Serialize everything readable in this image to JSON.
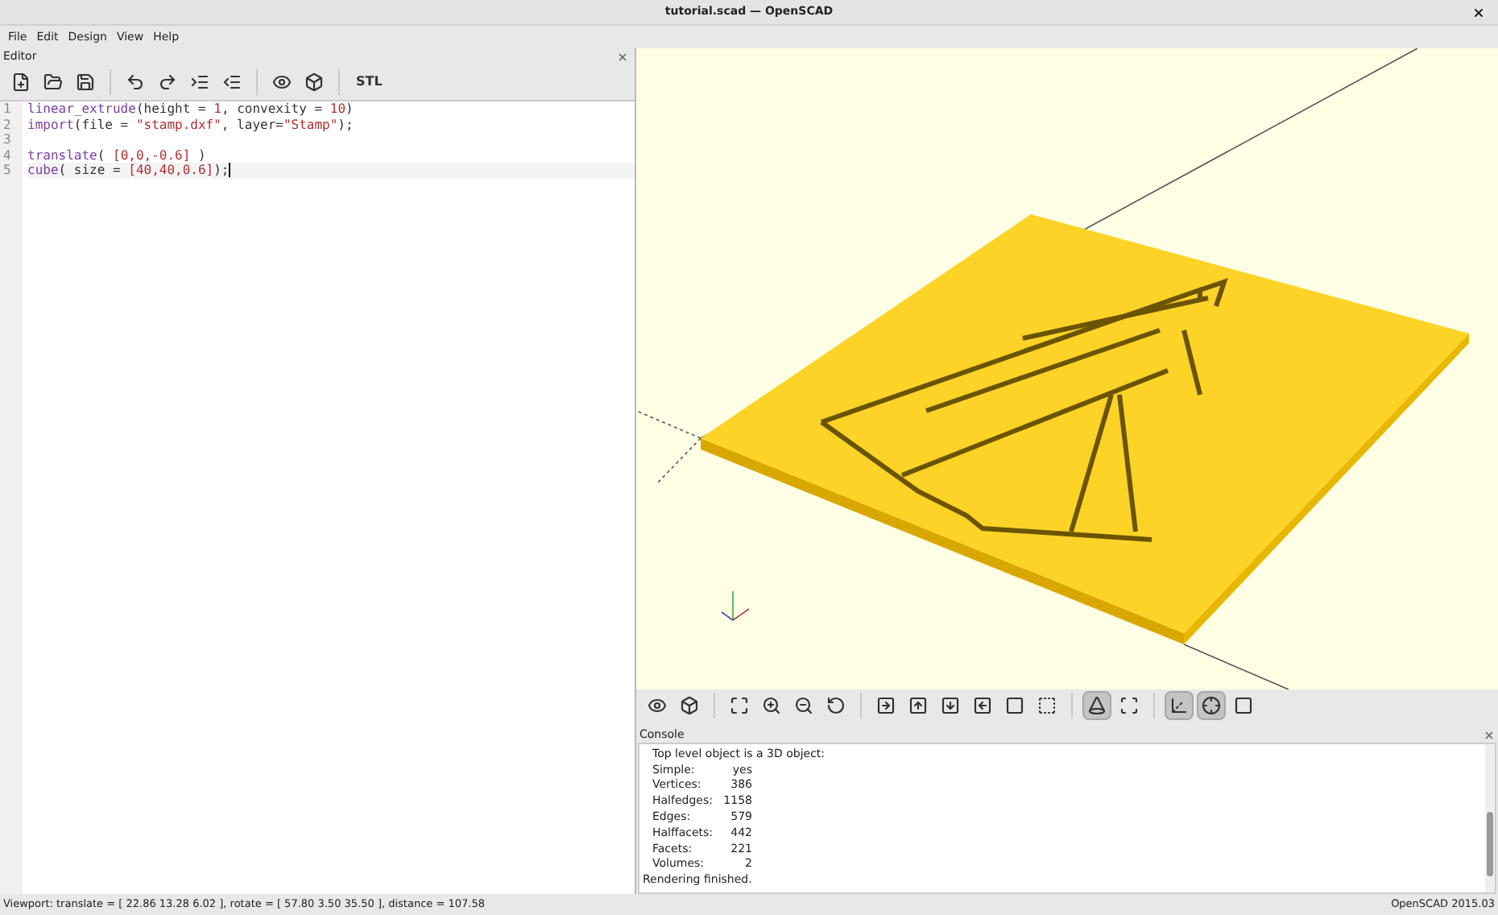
{
  "window": {
    "title": "tutorial.scad — OpenSCAD"
  },
  "menu": [
    "File",
    "Edit",
    "Design",
    "View",
    "Help"
  ],
  "editor": {
    "title": "Editor",
    "toolbar": [
      {
        "kind": "new"
      },
      {
        "kind": "open"
      },
      {
        "kind": "save"
      },
      {
        "kind": "sep"
      },
      {
        "kind": "undo"
      },
      {
        "kind": "redo"
      },
      {
        "kind": "indent"
      },
      {
        "kind": "unindent"
      },
      {
        "kind": "sep"
      },
      {
        "kind": "preview"
      },
      {
        "kind": "render"
      },
      {
        "kind": "sep"
      },
      {
        "kind": "stl",
        "label": "STL"
      }
    ],
    "lines": [
      {
        "number": "1",
        "tokens": [
          {
            "text": "linear_extrude",
            "kind": "keyword"
          },
          {
            "text": "(height = ",
            "kind": "plain"
          },
          {
            "text": "1",
            "kind": "number"
          },
          {
            "text": ", convexity = ",
            "kind": "plain"
          },
          {
            "text": "10",
            "kind": "number"
          },
          {
            "text": ")",
            "kind": "plain"
          }
        ]
      },
      {
        "number": "2",
        "tokens": [
          {
            "text": "import",
            "kind": "keyword"
          },
          {
            "text": "(file = ",
            "kind": "plain"
          },
          {
            "text": "\"stamp.dxf\"",
            "kind": "string"
          },
          {
            "text": ", layer=",
            "kind": "plain"
          },
          {
            "text": "\"Stamp\"",
            "kind": "string"
          },
          {
            "text": ");",
            "kind": "plain"
          }
        ]
      },
      {
        "number": "3"
      },
      {
        "number": "4",
        "tokens": [
          {
            "text": "translate",
            "kind": "keyword"
          },
          {
            "text": "( ",
            "kind": "plain"
          },
          {
            "text": "[0,0,-0.6]",
            "kind": "number"
          },
          {
            "text": " )",
            "kind": "plain"
          }
        ]
      },
      {
        "number": "5",
        "current": true,
        "tokens": [
          {
            "text": "cube",
            "kind": "keyword"
          },
          {
            "text": "( size = ",
            "kind": "plain"
          },
          {
            "text": "[40,40,0.6]",
            "kind": "number"
          },
          {
            "text": ");",
            "kind": "plain"
          }
        ]
      }
    ]
  },
  "view_toolbar": [
    {
      "kind": "preview",
      "pressed": false
    },
    {
      "kind": "render",
      "pressed": false
    },
    {
      "kind": "sep"
    },
    {
      "kind": "viewall",
      "pressed": false
    },
    {
      "kind": "zoomin",
      "pressed": false
    },
    {
      "kind": "zoomout",
      "pressed": false
    },
    {
      "kind": "reset",
      "pressed": false
    },
    {
      "kind": "sep"
    },
    {
      "kind": "right",
      "pressed": false
    },
    {
      "kind": "top",
      "pressed": false
    },
    {
      "kind": "bottom",
      "pressed": false
    },
    {
      "kind": "left",
      "pressed": false
    },
    {
      "kind": "front",
      "pressed": false
    },
    {
      "kind": "back",
      "pressed": false
    },
    {
      "kind": "sep"
    },
    {
      "kind": "perspective",
      "pressed": true
    },
    {
      "kind": "orthogonal",
      "pressed": false
    },
    {
      "kind": "sep"
    },
    {
      "kind": "axes",
      "pressed": true
    },
    {
      "kind": "crosshairs",
      "pressed": true
    },
    {
      "kind": "edges",
      "pressed": false
    }
  ],
  "console": {
    "title": "Console",
    "lines": [
      {
        "kind": "heading",
        "text": "Top level object is a 3D object:"
      },
      {
        "kind": "pair",
        "label": "Simple:",
        "value": "yes"
      },
      {
        "kind": "pair",
        "label": "Vertices:",
        "value": "386"
      },
      {
        "kind": "pair",
        "label": "Halfedges:",
        "value": "1158"
      },
      {
        "kind": "pair",
        "label": "Edges:",
        "value": "579"
      },
      {
        "kind": "pair",
        "label": "Halffacets:",
        "value": "442"
      },
      {
        "kind": "pair",
        "label": "Facets:",
        "value": "221"
      },
      {
        "kind": "pair",
        "label": "Volumes:",
        "value": "2"
      },
      {
        "kind": "plain",
        "text": "Rendering finished."
      }
    ]
  },
  "status_bar": {
    "viewport": "Viewport: translate = [ 22.86 13.28 6.02 ], rotate = [ 57.80 3.50 35.50 ], distance = 107.58",
    "version": "OpenSCAD 2015.03"
  }
}
